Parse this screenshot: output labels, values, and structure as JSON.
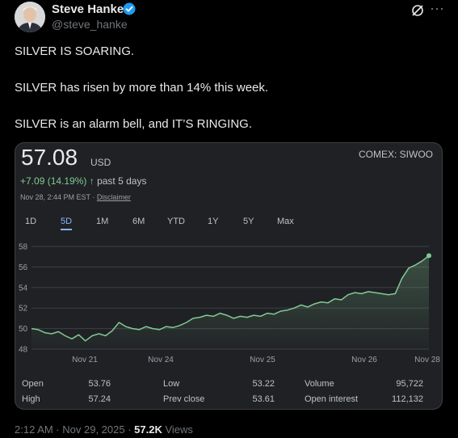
{
  "author": {
    "name": "Steve Hanke",
    "handle": "@steve_hanke"
  },
  "tweet": {
    "lines": [
      "SILVER IS SOARING.",
      "SILVER has risen by more than 14% this week.",
      "SILVER is an alarm bell, and IT’S RINGING."
    ]
  },
  "quote": {
    "price": "57.08",
    "currency": "USD",
    "ticker": "COMEX: SIWOO",
    "change": "+7.09 (14.19%)",
    "change_arrow": "↑",
    "change_period": "past 5 days",
    "timestamp": "Nov 28, 2:44 PM EST · ",
    "disclaimer": "Disclaimer",
    "ranges": [
      "1D",
      "5D",
      "1M",
      "6M",
      "YTD",
      "1Y",
      "5Y",
      "Max"
    ],
    "active_range": "5D",
    "stats": {
      "open_label": "Open",
      "open": "53.76",
      "high_label": "High",
      "high": "57.24",
      "low_label": "Low",
      "low": "53.22",
      "prev_close_label": "Prev close",
      "prev_close": "53.61",
      "volume_label": "Volume",
      "volume": "95,722",
      "open_interest_label": "Open interest",
      "open_interest": "112,132"
    }
  },
  "chart_data": {
    "type": "area",
    "x_ticks": [
      "Nov 21",
      "Nov 24",
      "Nov 25",
      "Nov 26",
      "Nov 28"
    ],
    "y_ticks": [
      48,
      50,
      52,
      54,
      56,
      58
    ],
    "ylim": [
      48,
      58
    ],
    "baseline": 50,
    "line_color": "#81c995",
    "values": [
      50.0,
      49.9,
      49.6,
      49.5,
      49.7,
      49.3,
      49.0,
      49.4,
      48.8,
      49.3,
      49.5,
      49.3,
      49.8,
      50.6,
      50.2,
      50.0,
      49.9,
      50.2,
      50.0,
      49.9,
      50.2,
      50.1,
      50.3,
      50.6,
      51.0,
      51.1,
      51.3,
      51.2,
      51.5,
      51.3,
      51.0,
      51.2,
      51.1,
      51.3,
      51.2,
      51.5,
      51.4,
      51.7,
      51.8,
      52.0,
      52.3,
      52.1,
      52.4,
      52.6,
      52.5,
      52.9,
      52.8,
      53.3,
      53.5,
      53.4,
      53.6,
      53.5,
      53.4,
      53.3,
      53.4,
      54.9,
      55.9,
      56.2,
      56.6,
      57.1
    ]
  },
  "meta": {
    "time": "2:12 AM · Nov 29, 2025 · ",
    "views_count": "57.2K",
    "views_label": " Views"
  }
}
